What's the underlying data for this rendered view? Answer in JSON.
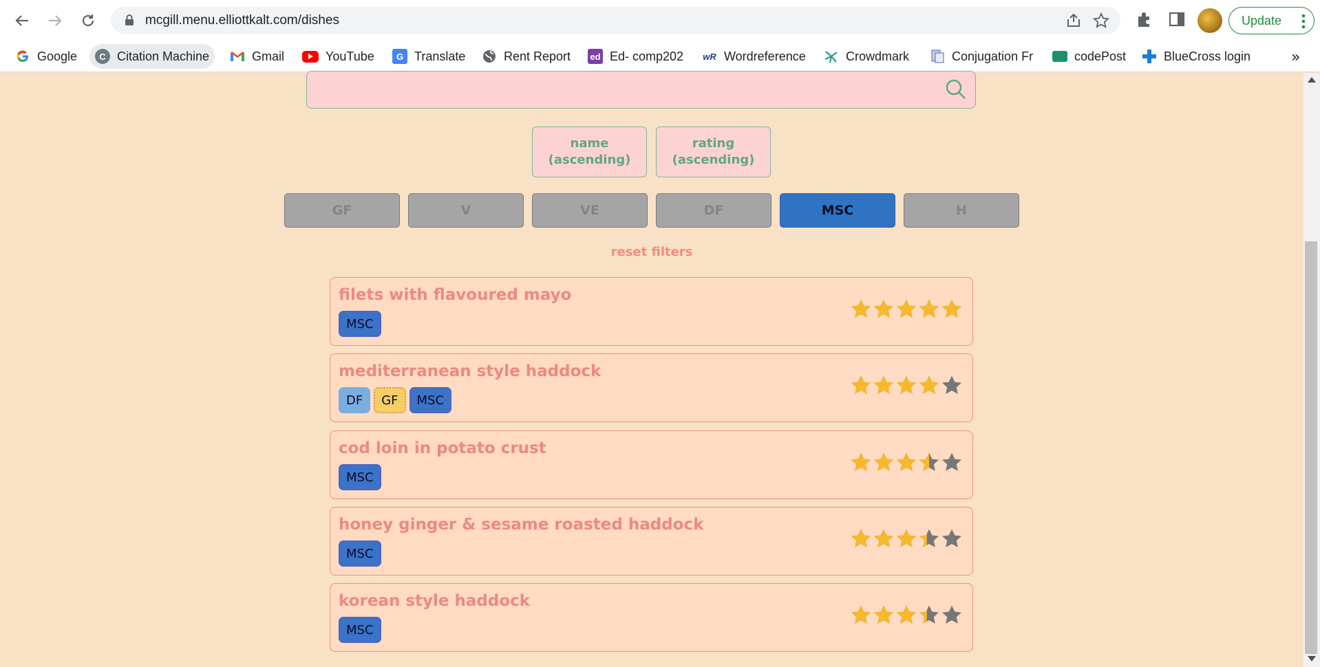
{
  "browser": {
    "url": "mcgill.menu.elliottkalt.com/dishes",
    "update_label": "Update"
  },
  "bookmarks": [
    {
      "label": "Google",
      "icon": "google-icon"
    },
    {
      "label": "Citation Machine",
      "icon": "citation-machine-icon"
    },
    {
      "label": "Gmail",
      "icon": "gmail-icon"
    },
    {
      "label": "YouTube",
      "icon": "youtube-icon"
    },
    {
      "label": "Translate",
      "icon": "translate-icon"
    },
    {
      "label": "Rent Report",
      "icon": "globe-icon"
    },
    {
      "label": "Ed- comp202",
      "icon": "ed-icon"
    },
    {
      "label": "Wordreference",
      "icon": "wordreference-icon"
    },
    {
      "label": "Crowdmark",
      "icon": "crowdmark-icon"
    },
    {
      "label": "Conjugation Fr",
      "icon": "conjugation-icon"
    },
    {
      "label": "codePost",
      "icon": "codepost-icon"
    },
    {
      "label": "BlueCross login",
      "icon": "bluecross-icon"
    }
  ],
  "search": {
    "value": "",
    "placeholder": ""
  },
  "sort": {
    "name": {
      "line1": "name",
      "line2": "(ascending)"
    },
    "rating": {
      "line1": "rating",
      "line2": "(ascending)"
    }
  },
  "filters": [
    {
      "label": "GF",
      "active": false
    },
    {
      "label": "V",
      "active": false
    },
    {
      "label": "VE",
      "active": false
    },
    {
      "label": "DF",
      "active": false
    },
    {
      "label": "MSC",
      "active": true
    },
    {
      "label": "H",
      "active": false
    }
  ],
  "reset_label": "reset filters",
  "dishes": [
    {
      "name": "filets with flavoured mayo",
      "tags": [
        "MSC"
      ],
      "rating": 5
    },
    {
      "name": "mediterranean style haddock",
      "tags": [
        "DF",
        "GF",
        "MSC"
      ],
      "rating": 4
    },
    {
      "name": "cod loin in potato crust",
      "tags": [
        "MSC"
      ],
      "rating": 3.5
    },
    {
      "name": "honey ginger & sesame roasted haddock",
      "tags": [
        "MSC"
      ],
      "rating": 3.4
    },
    {
      "name": "korean style haddock",
      "tags": [
        "MSC"
      ],
      "rating": 3.4
    }
  ],
  "colors": {
    "star_filled": "#f6b92b",
    "star_empty": "#777777",
    "page_bg": "#f9e1c6",
    "filter_active": "#2f73c2"
  }
}
